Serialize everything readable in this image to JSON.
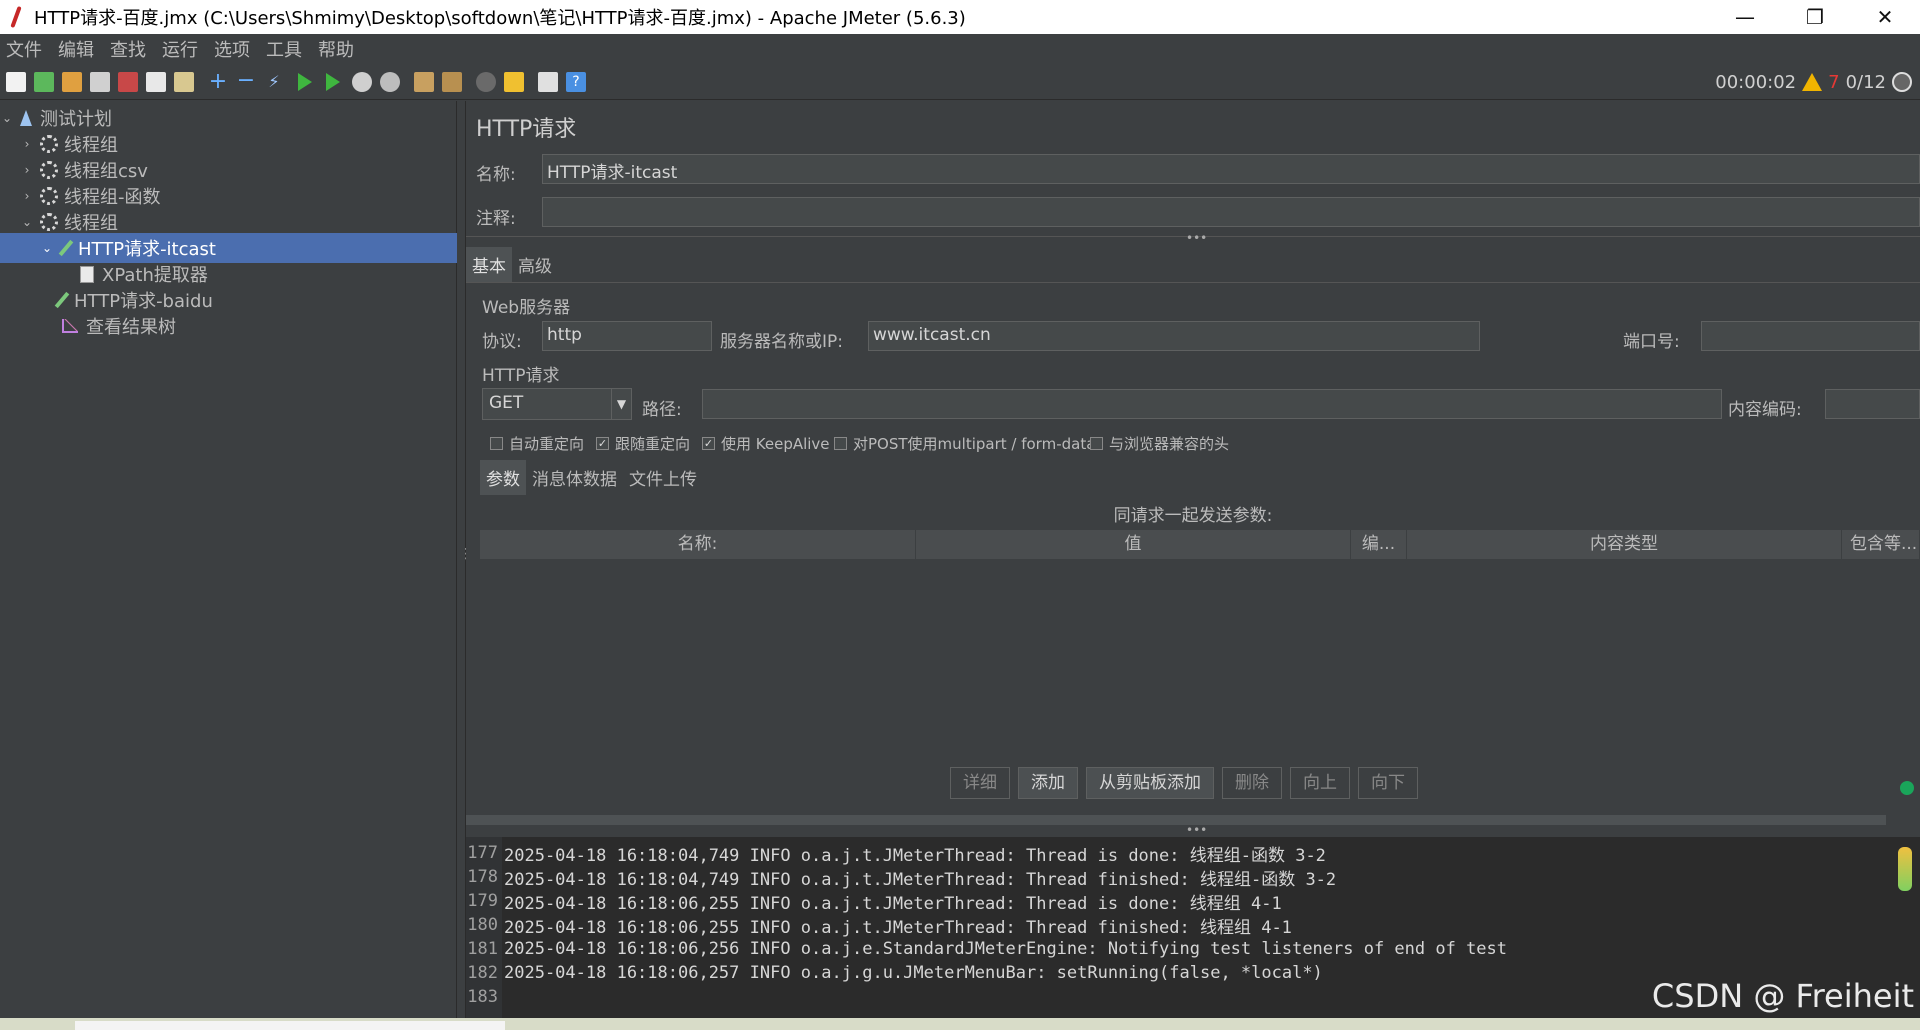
{
  "window": {
    "title": "HTTP请求-百度.jmx (C:\\Users\\Shmimy\\Desktop\\softdown\\笔记\\HTTP请求-百度.jmx) - Apache JMeter (5.6.3)",
    "minimize": "—",
    "maximize": "❐",
    "close": "✕"
  },
  "menu": [
    "文件",
    "编辑",
    "查找",
    "运行",
    "选项",
    "工具",
    "帮助"
  ],
  "toolbar": {
    "icons": [
      "new-icon",
      "templates-icon",
      "open-icon",
      "save-icon",
      "cut-icon",
      "copy-icon",
      "paste-icon",
      "expand-icon",
      "collapse-icon",
      "toggle-icon",
      "start-icon",
      "start-no-pause-icon",
      "stop-icon",
      "shutdown-icon",
      "clear-icon",
      "clear-all-icon",
      "search-icon",
      "reset-search-icon",
      "function-helper-icon",
      "help-icon"
    ],
    "elapsed": "00:00:02",
    "warnings": "7",
    "threads": "0/12"
  },
  "tree": {
    "root": "测试计划",
    "items": [
      {
        "label": "线程组"
      },
      {
        "label": "线程组csv"
      },
      {
        "label": "线程组-函数"
      },
      {
        "label": "线程组"
      },
      {
        "label": "HTTP请求-itcast"
      },
      {
        "label": "XPath提取器"
      },
      {
        "label": "HTTP请求-baidu"
      },
      {
        "label": "查看结果树"
      }
    ]
  },
  "panel": {
    "title": "HTTP请求",
    "name_label": "名称:",
    "name_value": "HTTP请求-itcast",
    "comment_label": "注释:",
    "comment_value": "",
    "tabs": [
      "基本",
      "高级"
    ],
    "web_server": {
      "group": "Web服务器",
      "protocol_label": "协议:",
      "protocol_value": "http",
      "server_label": "服务器名称或IP:",
      "server_value": "www.itcast.cn",
      "port_label": "端口号:",
      "port_value": ""
    },
    "http_request": {
      "group": "HTTP请求",
      "method": "GET",
      "path_label": "路径:",
      "path_value": "",
      "encoding_label": "内容编码:",
      "encoding_value": ""
    },
    "checkboxes": [
      {
        "label": "自动重定向",
        "checked": false
      },
      {
        "label": "跟随重定向",
        "checked": true
      },
      {
        "label": "使用 KeepAlive",
        "checked": true
      },
      {
        "label": "对POST使用multipart / form-data",
        "checked": false
      },
      {
        "label": "与浏览器兼容的头",
        "checked": false
      }
    ],
    "subtabs": [
      "参数",
      "消息体数据",
      "文件上传"
    ],
    "params_caption": "同请求一起发送参数:",
    "columns": [
      "名称:",
      "值",
      "编...",
      "内容类型",
      "包含等..."
    ],
    "buttons": [
      {
        "label": "详细",
        "enabled": false
      },
      {
        "label": "添加",
        "enabled": true
      },
      {
        "label": "从剪贴板添加",
        "enabled": true
      },
      {
        "label": "删除",
        "enabled": false
      },
      {
        "label": "向上",
        "enabled": false
      },
      {
        "label": "向下",
        "enabled": false
      }
    ]
  },
  "log": {
    "lines": [
      {
        "n": "177",
        "text": "2025-04-18 16:18:04,749 INFO o.a.j.t.JMeterThread: Thread is done: 线程组-函数 3-2"
      },
      {
        "n": "178",
        "text": "2025-04-18 16:18:04,749 INFO o.a.j.t.JMeterThread: Thread finished: 线程组-函数 3-2"
      },
      {
        "n": "179",
        "text": "2025-04-18 16:18:06,255 INFO o.a.j.t.JMeterThread: Thread is done: 线程组 4-1"
      },
      {
        "n": "180",
        "text": "2025-04-18 16:18:06,255 INFO o.a.j.t.JMeterThread: Thread finished: 线程组 4-1"
      },
      {
        "n": "181",
        "text": "2025-04-18 16:18:06,256 INFO o.a.j.e.StandardJMeterEngine: Notifying test listeners of end of test"
      },
      {
        "n": "182",
        "text": "2025-04-18 16:18:06,257 INFO o.a.j.g.u.JMeterMenuBar: setRunning(false, *local*)"
      },
      {
        "n": "183",
        "text": ""
      }
    ]
  },
  "watermark": "CSDN @ Freiheit",
  "colors": {
    "background": "#3c3f41",
    "selection": "#4b6eaf",
    "log_background": "#2b2b2b",
    "warning": "#f0b400",
    "warning_count": "#e53935",
    "status_dot": "#1aa55a"
  }
}
